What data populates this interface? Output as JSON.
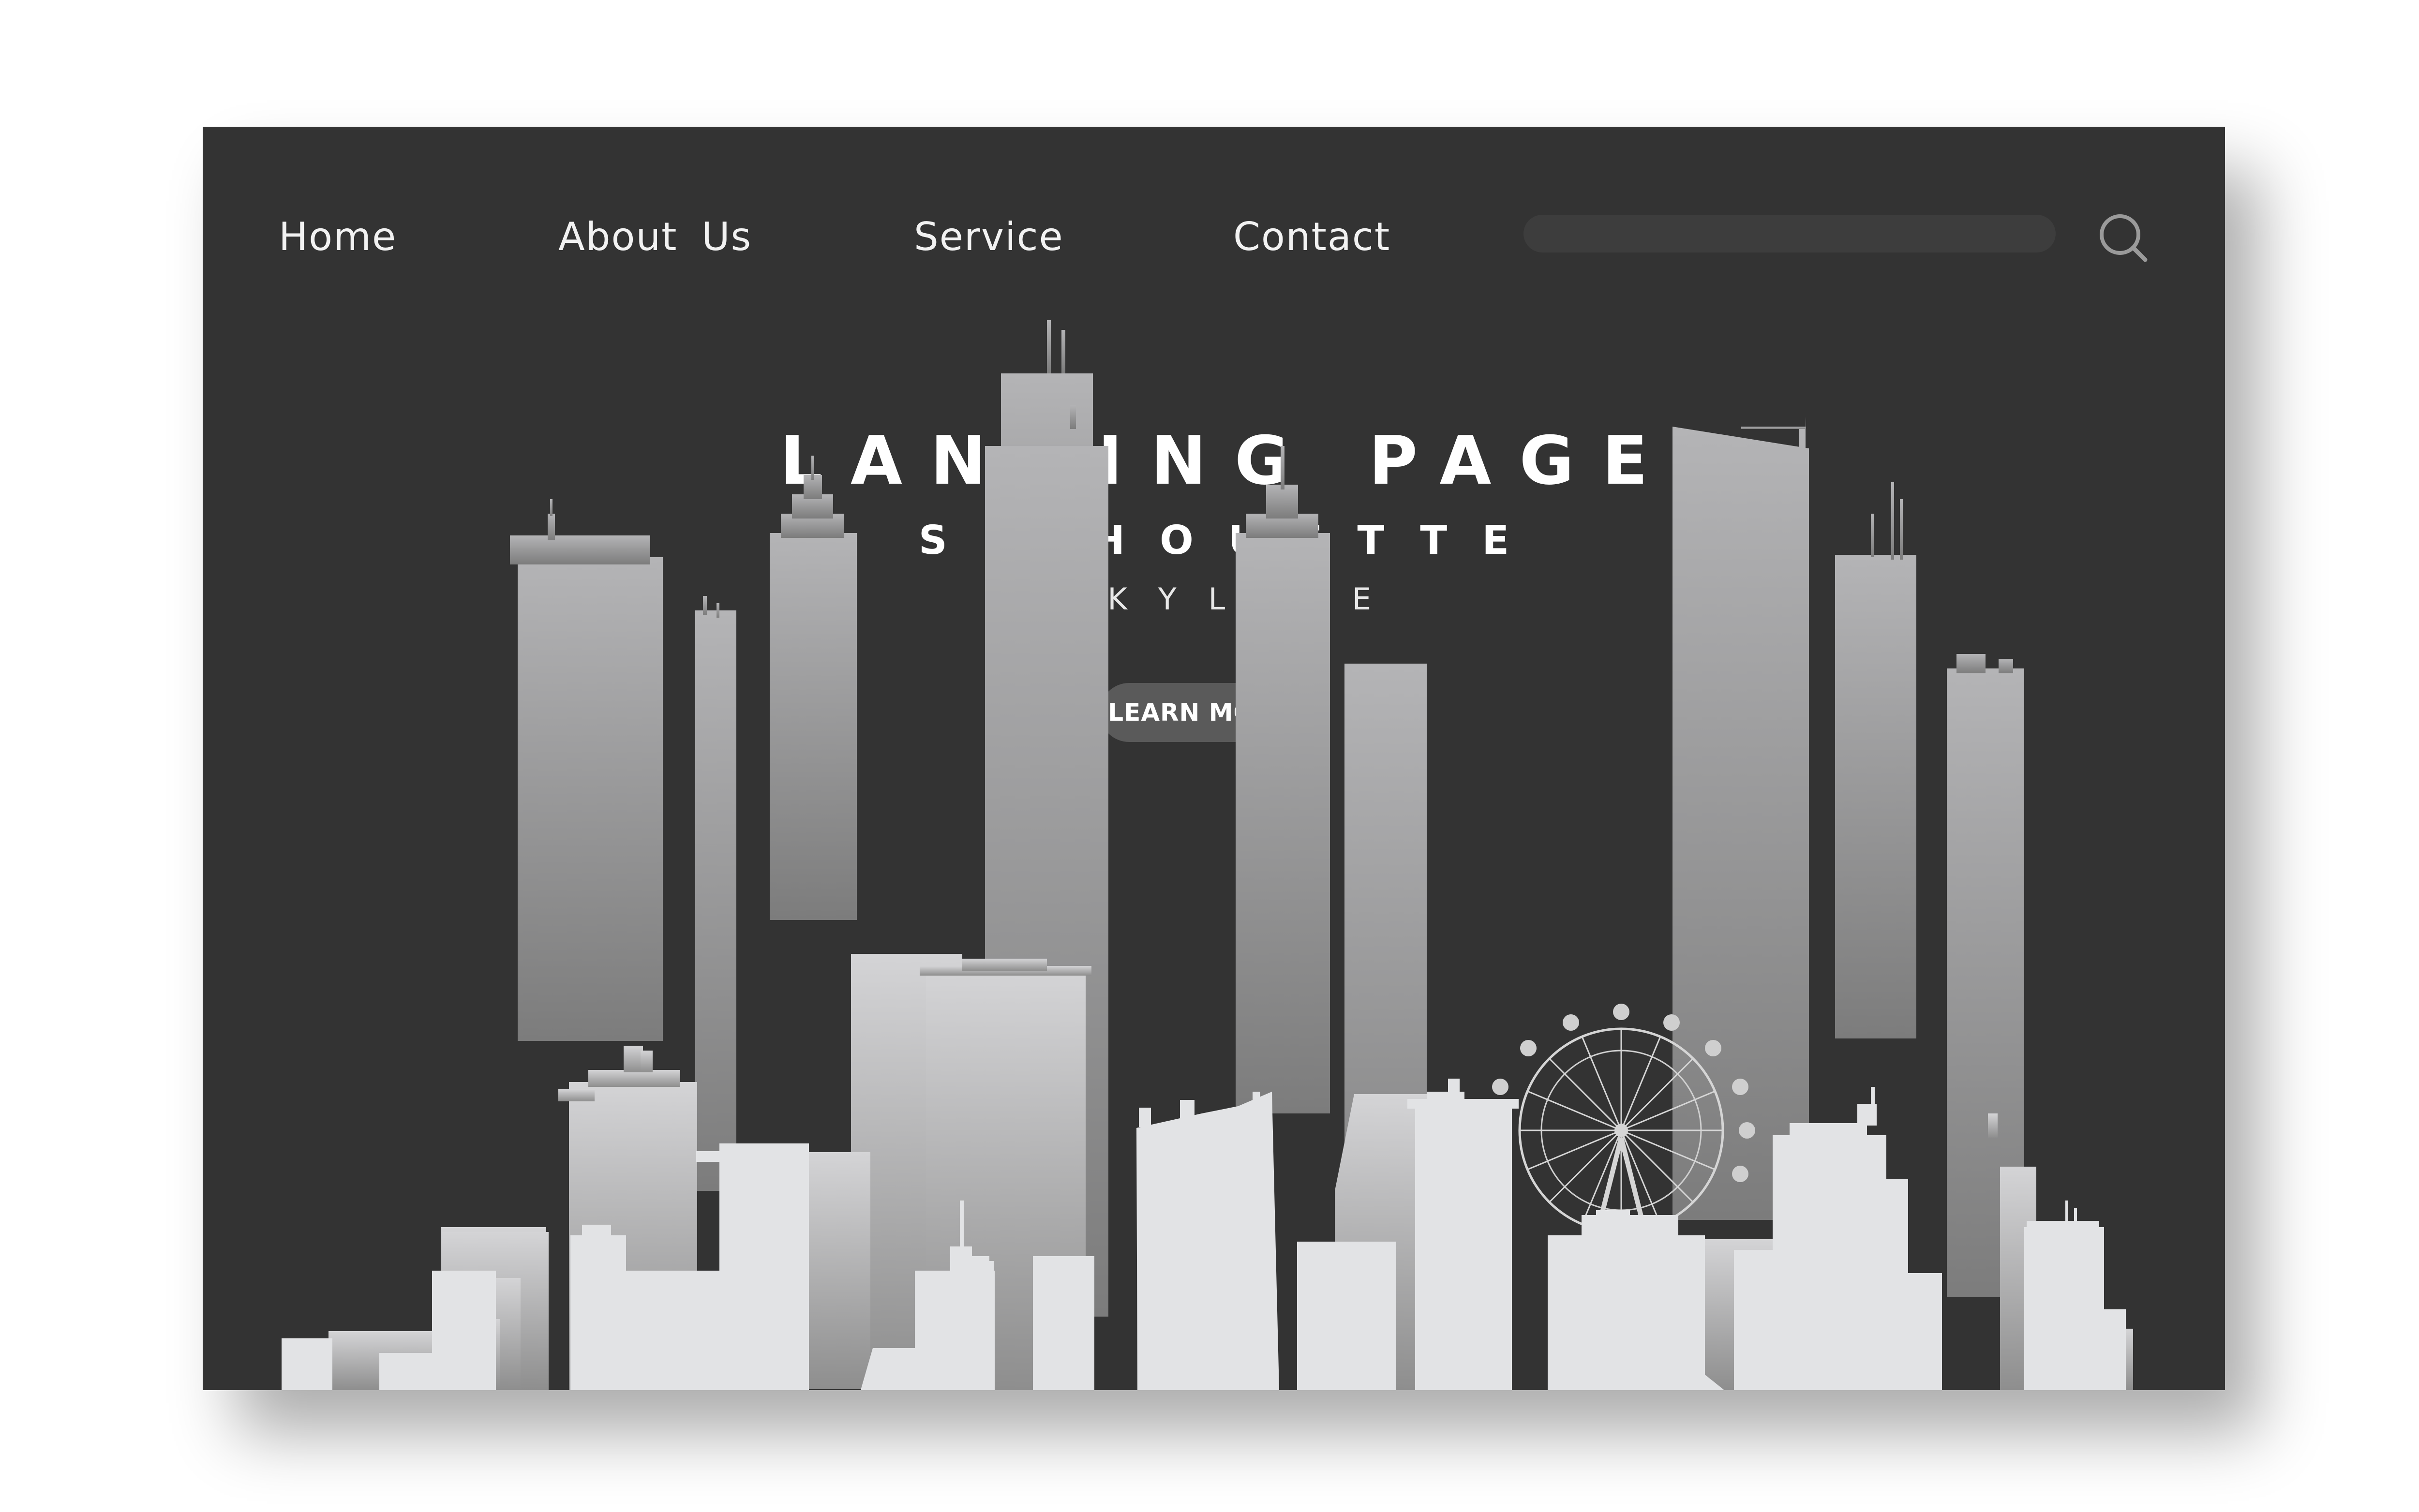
{
  "nav": {
    "items": [
      {
        "label": "Home"
      },
      {
        "label": "About  Us"
      },
      {
        "label": "Service"
      },
      {
        "label": "Contact"
      }
    ],
    "search_placeholder": "",
    "search_icon": "search-icon"
  },
  "hero": {
    "title": "LANDING PAGE",
    "subtitle": "SILHOUETTE",
    "tagline": "SKYLINE",
    "button_label": "LEARN MORE"
  },
  "colors": {
    "page_background": "#ffffff",
    "panel_background": "#333333",
    "search_field": "#3d3d3d",
    "button_background": "#5a5a5a",
    "back_buildings": "#9a9a9a",
    "mid_buildings": "#c4c4c4",
    "front_buildings": "#e2e3e5"
  }
}
